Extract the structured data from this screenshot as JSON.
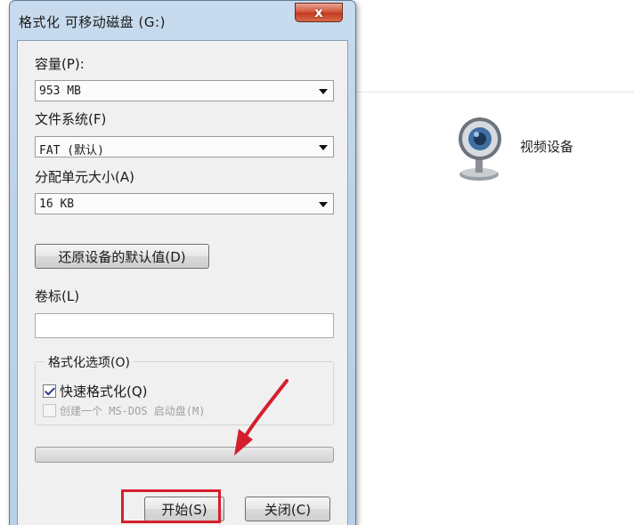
{
  "dialog": {
    "title": "格式化 可移动磁盘 (G:)",
    "close_label": "x"
  },
  "capacity": {
    "label": "容量(P):",
    "value": "953 MB"
  },
  "filesystem": {
    "label": "文件系统(F)",
    "value": "FAT (默认)"
  },
  "allocation": {
    "label": "分配单元大小(A)",
    "value": "16 KB"
  },
  "restore_defaults_label": "还原设备的默认值(D)",
  "volume_label": {
    "label": "卷标(L)",
    "value": ""
  },
  "format_options": {
    "title": "格式化选项(O)",
    "quick_format": {
      "label": "快速格式化(Q)",
      "checked": true
    },
    "msdos_startup": {
      "label": "创建一个 MS-DOS 启动盘(M)",
      "checked": false,
      "disabled": true
    }
  },
  "progress": {
    "value": 0
  },
  "buttons": {
    "start_label": "开始(S)",
    "close_label": "关闭(C)"
  },
  "background": {
    "device_label": "视频设备",
    "device_icon": "webcam-icon"
  },
  "annotation": {
    "highlight_color": "#d41f2c"
  }
}
